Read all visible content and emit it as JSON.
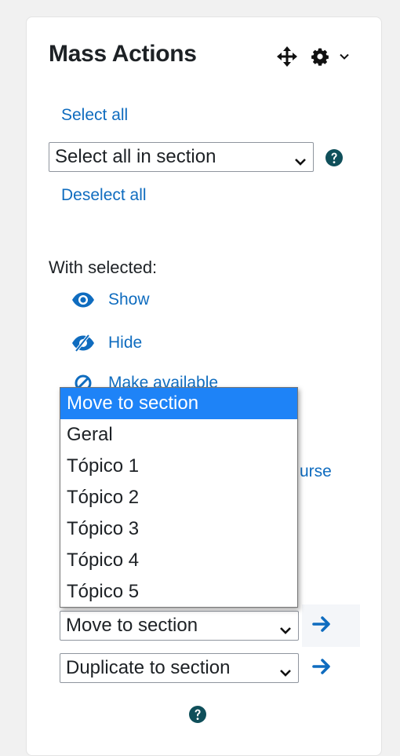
{
  "block": {
    "title": "Mass Actions",
    "icons": [
      "move-icon",
      "gear-icon",
      "chevron-down-icon"
    ]
  },
  "selection": {
    "select_all": "Select all",
    "section_select_value": "Select all in section",
    "deselect_all": "Deselect all"
  },
  "actions": {
    "heading": "With selected:",
    "show": "Show",
    "hide": "Hide",
    "make_available_partial": "Make available",
    "course_partial": "urse"
  },
  "dropdown": {
    "options": [
      "Move to section",
      "Geral",
      "Tópico 1",
      "Tópico 2",
      "Tópico 3",
      "Tópico 4",
      "Tópico 5"
    ],
    "selected_index": 0
  },
  "move_select": {
    "value": "Move to section"
  },
  "duplicate_select": {
    "value": "Duplicate to section"
  },
  "colors": {
    "link": "#0f6cbf",
    "highlight": "#1e83f7",
    "help": "#0f4f5a"
  }
}
